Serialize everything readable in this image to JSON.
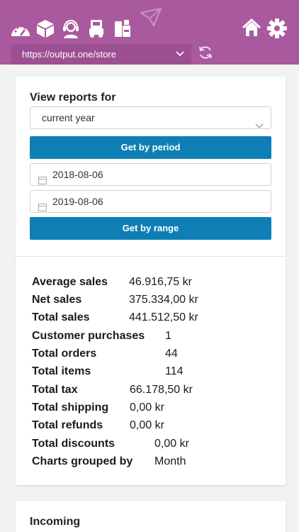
{
  "header": {
    "toolbar_icons": [
      "dashboard-gauge-icon",
      "package-box-icon",
      "support-agent-icon",
      "truck-icon",
      "printer-icon",
      "paper-plane-icon"
    ],
    "url": "https://output.one/store",
    "colors": {
      "topbar": "#a9599e",
      "accent": "#0e7fb5"
    }
  },
  "reports": {
    "title": "View reports for",
    "period_selected": "current year",
    "get_by_period_label": "Get by period",
    "date_from": "2018-08-06",
    "date_to": "2019-08-06",
    "get_by_range_label": "Get by range"
  },
  "stats": [
    {
      "label": "Average sales",
      "value": "46.916,75 kr"
    },
    {
      "label": "Net sales",
      "value": "375.334,00 kr"
    },
    {
      "label": "Total sales",
      "value": "441.512,50 kr"
    },
    {
      "label": "Customer purchases",
      "value": "1"
    },
    {
      "label": "Total orders",
      "value": "44"
    },
    {
      "label": "Total items",
      "value": "114"
    },
    {
      "label": "Total tax",
      "value": "66.178,50 kr"
    },
    {
      "label": "Total shipping",
      "value": "0,00 kr"
    },
    {
      "label": "Total refunds",
      "value": "0,00 kr"
    },
    {
      "label": "Total discounts",
      "value": "0,00 kr"
    },
    {
      "label": "Charts grouped by",
      "value": "Month"
    }
  ],
  "incoming": {
    "title": "Incoming"
  }
}
